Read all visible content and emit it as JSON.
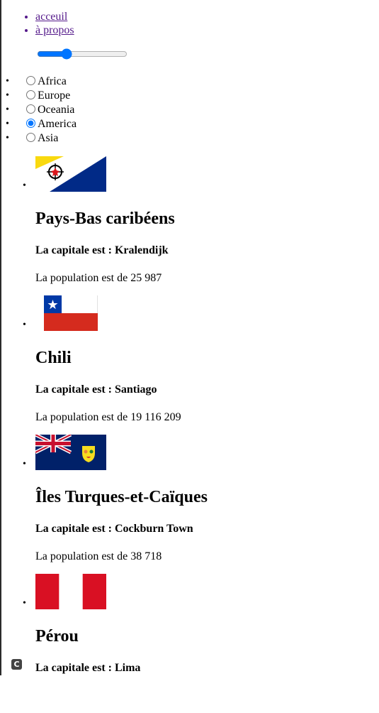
{
  "nav": [
    {
      "label": "acceuil"
    },
    {
      "label": "à propos"
    }
  ],
  "slider": {
    "value": 30,
    "min": 0,
    "max": 100
  },
  "regions": [
    {
      "label": "Africa",
      "checked": false
    },
    {
      "label": "Europe",
      "checked": false
    },
    {
      "label": "Oceania",
      "checked": false
    },
    {
      "label": "America",
      "checked": true
    },
    {
      "label": "Asia",
      "checked": false
    }
  ],
  "countries": [
    {
      "name": "Pays-Bas caribéens",
      "capital": "La capitale est : Kralendijk",
      "population": "La population est de 25 987",
      "flag": "caribbean-netherlands-flag"
    },
    {
      "name": "Chili",
      "capital": "La capitale est : Santiago",
      "population": "La population est de 19 116 209",
      "flag": "chile-flag"
    },
    {
      "name": "Îles Turques-et-Caïques",
      "capital": "La capitale est : Cockburn Town",
      "population": "La population est de 38 718",
      "flag": "turks-and-caicos-flag"
    },
    {
      "name": "Pérou",
      "capital": "La capitale est : Lima",
      "population": "",
      "flag": "peru-flag"
    }
  ],
  "badge": {
    "icon": "c-logo-icon",
    "glyph": "C"
  }
}
